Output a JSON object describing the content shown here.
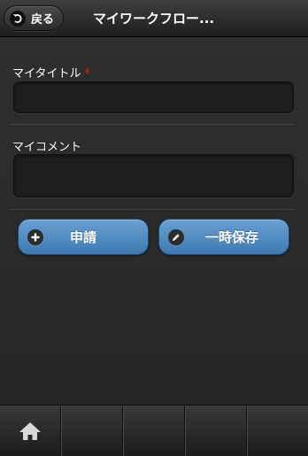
{
  "header": {
    "back_label": "戻る",
    "title": "マイワークフロー..."
  },
  "form": {
    "title_label": "マイタイトル",
    "required_mark": "*",
    "title_value": "",
    "comment_label": "マイコメント",
    "comment_value": ""
  },
  "actions": {
    "apply_label": "申請",
    "save_draft_label": "一時保存"
  },
  "footer": {
    "tabs": [
      {
        "icon": "home-icon"
      },
      {
        "icon": ""
      },
      {
        "icon": ""
      },
      {
        "icon": ""
      },
      {
        "icon": ""
      }
    ]
  },
  "colors": {
    "accent": "#4f8cc4",
    "required": "#e02020"
  }
}
